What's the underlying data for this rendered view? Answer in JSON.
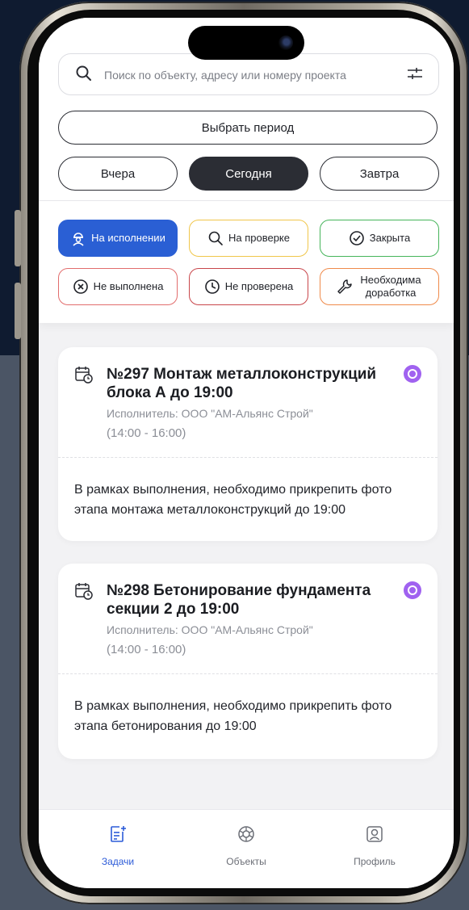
{
  "search": {
    "placeholder": "Поиск по объекту, адресу или номеру проекта"
  },
  "period": {
    "select_label": "Выбрать период"
  },
  "days": [
    {
      "label": "Вчера",
      "active": false
    },
    {
      "label": "Сегодня",
      "active": true
    },
    {
      "label": "Завтра",
      "active": false
    }
  ],
  "statuses": [
    {
      "label": "На исполнении",
      "icon": "worker-icon",
      "color": "#2a5fd4",
      "active": true
    },
    {
      "label": "На проверке",
      "icon": "search-icon",
      "color": "#f0c64a",
      "active": false
    },
    {
      "label": "Закрыта",
      "icon": "check-circle-icon",
      "color": "#45b45a",
      "active": false
    },
    {
      "label": "Не выполнена",
      "icon": "x-circle-icon",
      "color": "#e26d6d",
      "active": false
    },
    {
      "label": "Не проверена",
      "icon": "clock-icon",
      "color": "#c8454a",
      "active": false
    },
    {
      "label": "Необходима доработка",
      "icon": "wrench-icon",
      "color": "#ef8a4a",
      "active": false
    }
  ],
  "tasks": [
    {
      "title": "№297 Монтаж металлоконструкций блока А до 19:00",
      "executor": "Исполнитель: ООО \"АМ-Альянс Строй\"",
      "time": "(14:00 - 16:00)",
      "description": "В рамках выполнения, необходимо прикрепить фото этапа монтажа металлоконструкций до 19:00"
    },
    {
      "title": "№298 Бетонирование фундамента секции 2 до 19:00",
      "executor": "Исполнитель: ООО \"АМ-Альянс Строй\"",
      "time": "(14:00 - 16:00)",
      "description": "В рамках выполнения, необходимо прикрепить фото этапа бетонирования до 19:00"
    }
  ],
  "tabbar": [
    {
      "label": "Задачи",
      "icon": "tasks-icon",
      "active": true
    },
    {
      "label": "Объекты",
      "icon": "objects-icon",
      "active": false
    },
    {
      "label": "Профиль",
      "icon": "profile-icon",
      "active": false
    }
  ],
  "colors": {
    "accent": "#2a5fd4",
    "dark": "#2b2d34",
    "badge": "#a062f0"
  }
}
